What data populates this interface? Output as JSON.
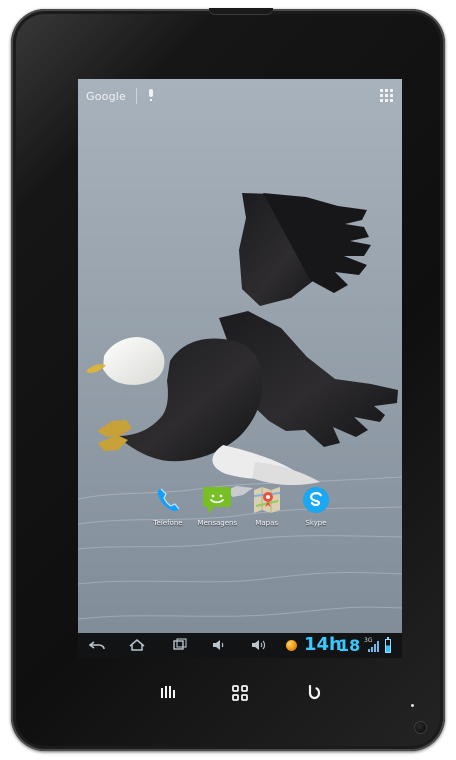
{
  "search": {
    "label": "Google"
  },
  "shortcuts": [
    {
      "label": "Telefone",
      "icon": "phone-icon"
    },
    {
      "label": "Mensagens",
      "icon": "message-icon"
    },
    {
      "label": "Mapas",
      "icon": "maps-icon"
    },
    {
      "label": "Skype",
      "icon": "skype-icon"
    }
  ],
  "status": {
    "hour": "14h",
    "minute": "18",
    "network": "3G"
  },
  "icons": {
    "apps": "apps-icon",
    "search": "google-search-icon",
    "mic": "microphone-icon",
    "back": "back-arrow-icon",
    "home": "home-icon",
    "recent": "recent-apps-icon",
    "volume_down": "volume-down-icon",
    "volume_up": "volume-up-icon",
    "notification": "notification-icon",
    "signal": "signal-icon",
    "battery": "battery-icon",
    "menu": "menu-icon",
    "grid": "grid-icon",
    "power": "power-icon"
  },
  "colors": {
    "accent": "#3bc8ff",
    "device": "#0f0f0f",
    "wallpaper": "#8e98a1"
  }
}
